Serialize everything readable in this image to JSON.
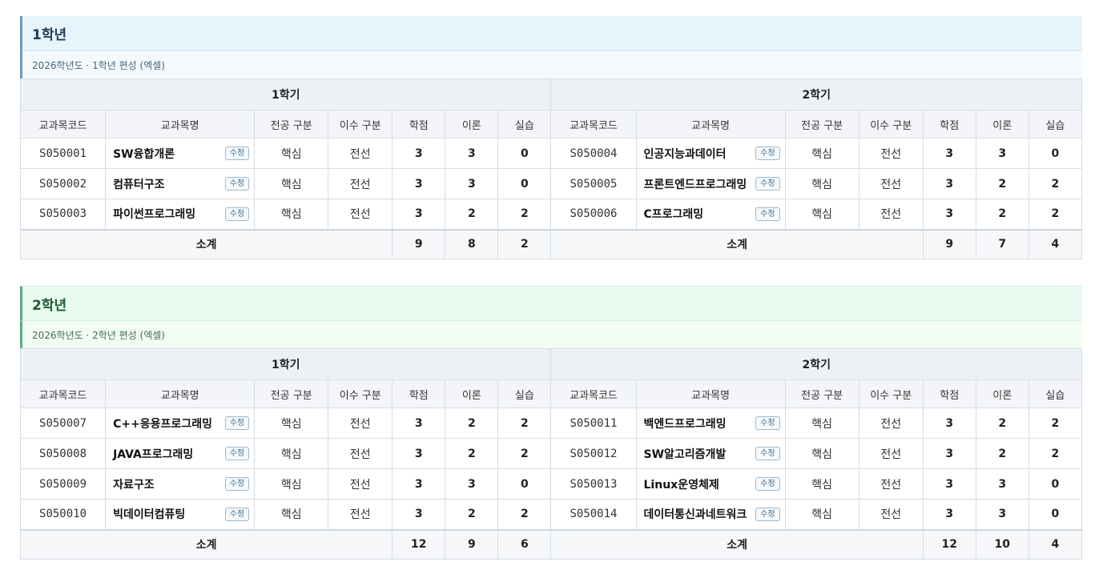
{
  "edit_label": "수정",
  "semester_labels": [
    "1학기",
    "2학기"
  ],
  "columns": {
    "code": "교과목코드",
    "name": "교과목명",
    "major": "전공 구분",
    "completion": "이수 구분",
    "credits": "학점",
    "theory": "이론",
    "practice": "실습"
  },
  "subtotal_label": "소계",
  "years": [
    {
      "title": "1학년",
      "subtitle": "2026학년도 · 1학년 편성 (엑셀)",
      "semesters": [
        {
          "courses": [
            {
              "code": "S050001",
              "name": "SW융합개론",
              "major": "핵심",
              "completion": "전선",
              "credits": "3",
              "theory": "3",
              "practice": "0"
            },
            {
              "code": "S050002",
              "name": "컴퓨터구조",
              "major": "핵심",
              "completion": "전선",
              "credits": "3",
              "theory": "3",
              "practice": "0"
            },
            {
              "code": "S050003",
              "name": "파이썬프로그래밍",
              "major": "핵심",
              "completion": "전선",
              "credits": "3",
              "theory": "2",
              "practice": "2"
            }
          ],
          "subtotal": {
            "credits": "9",
            "theory": "8",
            "practice": "2"
          }
        },
        {
          "courses": [
            {
              "code": "S050004",
              "name": "인공지능과데이터",
              "major": "핵심",
              "completion": "전선",
              "credits": "3",
              "theory": "3",
              "practice": "0"
            },
            {
              "code": "S050005",
              "name": "프론트엔드프로그래밍",
              "major": "핵심",
              "completion": "전선",
              "credits": "3",
              "theory": "2",
              "practice": "2"
            },
            {
              "code": "S050006",
              "name": "C프로그래밍",
              "major": "핵심",
              "completion": "전선",
              "credits": "3",
              "theory": "2",
              "practice": "2"
            }
          ],
          "subtotal": {
            "credits": "9",
            "theory": "7",
            "practice": "4"
          }
        }
      ]
    },
    {
      "title": "2학년",
      "subtitle": "2026학년도 · 2학년 편성 (엑셀)",
      "semesters": [
        {
          "courses": [
            {
              "code": "S050007",
              "name": "C++응용프로그래밍",
              "major": "핵심",
              "completion": "전선",
              "credits": "3",
              "theory": "2",
              "practice": "2"
            },
            {
              "code": "S050008",
              "name": "JAVA프로그래밍",
              "major": "핵심",
              "completion": "전선",
              "credits": "3",
              "theory": "2",
              "practice": "2"
            },
            {
              "code": "S050009",
              "name": "자료구조",
              "major": "핵심",
              "completion": "전선",
              "credits": "3",
              "theory": "3",
              "practice": "0"
            },
            {
              "code": "S050010",
              "name": "빅데이터컴퓨팅",
              "major": "핵심",
              "completion": "전선",
              "credits": "3",
              "theory": "2",
              "practice": "2"
            }
          ],
          "subtotal": {
            "credits": "12",
            "theory": "9",
            "practice": "6"
          }
        },
        {
          "courses": [
            {
              "code": "S050011",
              "name": "백엔드프로그래밍",
              "major": "핵심",
              "completion": "전선",
              "credits": "3",
              "theory": "2",
              "practice": "2"
            },
            {
              "code": "S050012",
              "name": "SW알고리즘개발",
              "major": "핵심",
              "completion": "전선",
              "credits": "3",
              "theory": "2",
              "practice": "2"
            },
            {
              "code": "S050013",
              "name": "Linux운영체제",
              "major": "핵심",
              "completion": "전선",
              "credits": "3",
              "theory": "3",
              "practice": "0"
            },
            {
              "code": "S050014",
              "name": "데이터통신과네트워크",
              "major": "핵심",
              "completion": "전선",
              "credits": "3",
              "theory": "3",
              "practice": "0"
            }
          ],
          "subtotal": {
            "credits": "12",
            "theory": "10",
            "practice": "4"
          }
        }
      ]
    }
  ]
}
